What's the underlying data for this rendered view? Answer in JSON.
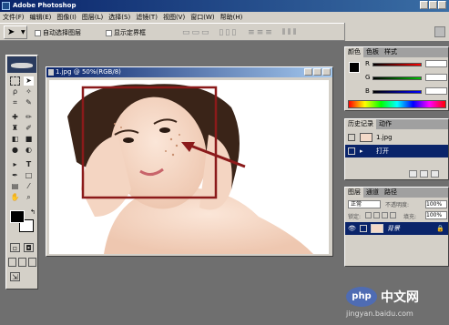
{
  "app": {
    "title": "Adobe Photoshop"
  },
  "menu": [
    "文件(F)",
    "编辑(E)",
    "图像(I)",
    "图层(L)",
    "选择(S)",
    "滤镜(T)",
    "视图(V)",
    "窗口(W)",
    "帮助(H)"
  ],
  "options": {
    "auto_select_layer": "自动选择图层",
    "show_bounding_box": "显示定界框"
  },
  "document": {
    "title": "1.jpg @ 50%(RGB/8)"
  },
  "color_panel": {
    "tabs": [
      "颜色",
      "色板",
      "样式"
    ],
    "channels": [
      {
        "label": "R",
        "color": "#ff0000"
      },
      {
        "label": "G",
        "color": "#00c000"
      },
      {
        "label": "B",
        "color": "#0000ff"
      }
    ]
  },
  "history_panel": {
    "tabs": [
      "历史记录",
      "动作"
    ],
    "items": [
      "1.jpg",
      "打开"
    ]
  },
  "layers_panel": {
    "tabs": [
      "图层",
      "通道",
      "路径"
    ],
    "blend_mode": "正常",
    "opacity_label": "不透明度:",
    "opacity_value": "100%",
    "lock_label": "锁定:",
    "fill_label": "填充:",
    "fill_value": "100%",
    "layer_name": "背景"
  },
  "watermark": {
    "text": "中文网",
    "url": "jingyan.baidu.com"
  },
  "colors": {
    "accent": "#0a246a",
    "highlight": "#0a246a",
    "annotation": "#8b1a1a"
  }
}
